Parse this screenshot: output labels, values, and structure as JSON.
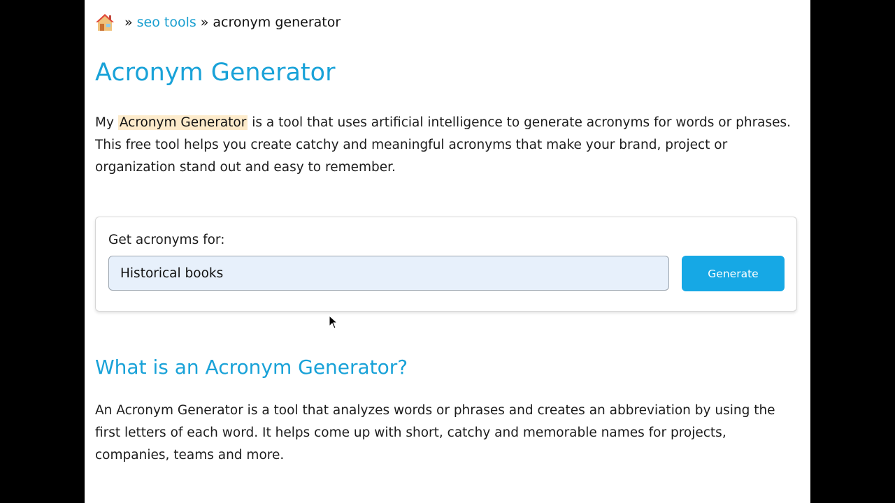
{
  "breadcrumb": {
    "home_icon": "house-icon",
    "separator": "»",
    "link_label": "seo tools",
    "current_label": "acronym generator"
  },
  "page_title": "Acronym Generator",
  "intro": {
    "before": "My",
    "highlight": "Acronym Generator",
    "after": "is a tool that uses artificial intelligence to generate acronyms for words or phrases. This free tool helps you create catchy and meaningful acronyms that make your brand, project or organization stand out and easy to remember."
  },
  "tool": {
    "label": "Get acronyms for:",
    "input_value": "Historical books",
    "button_label": "Generate"
  },
  "section": {
    "title": "What is an Acronym Generator?",
    "text": "An Acronym Generator is a tool that analyzes words or phrases and creates an abbreviation by using the first letters of each word. It helps come up with short, catchy and memorable names for projects, companies, teams and more."
  },
  "colors": {
    "accent": "#19a2d8",
    "button": "#16a8e5",
    "highlight": "#fdebcb",
    "input_bg": "#e7f0fb"
  }
}
